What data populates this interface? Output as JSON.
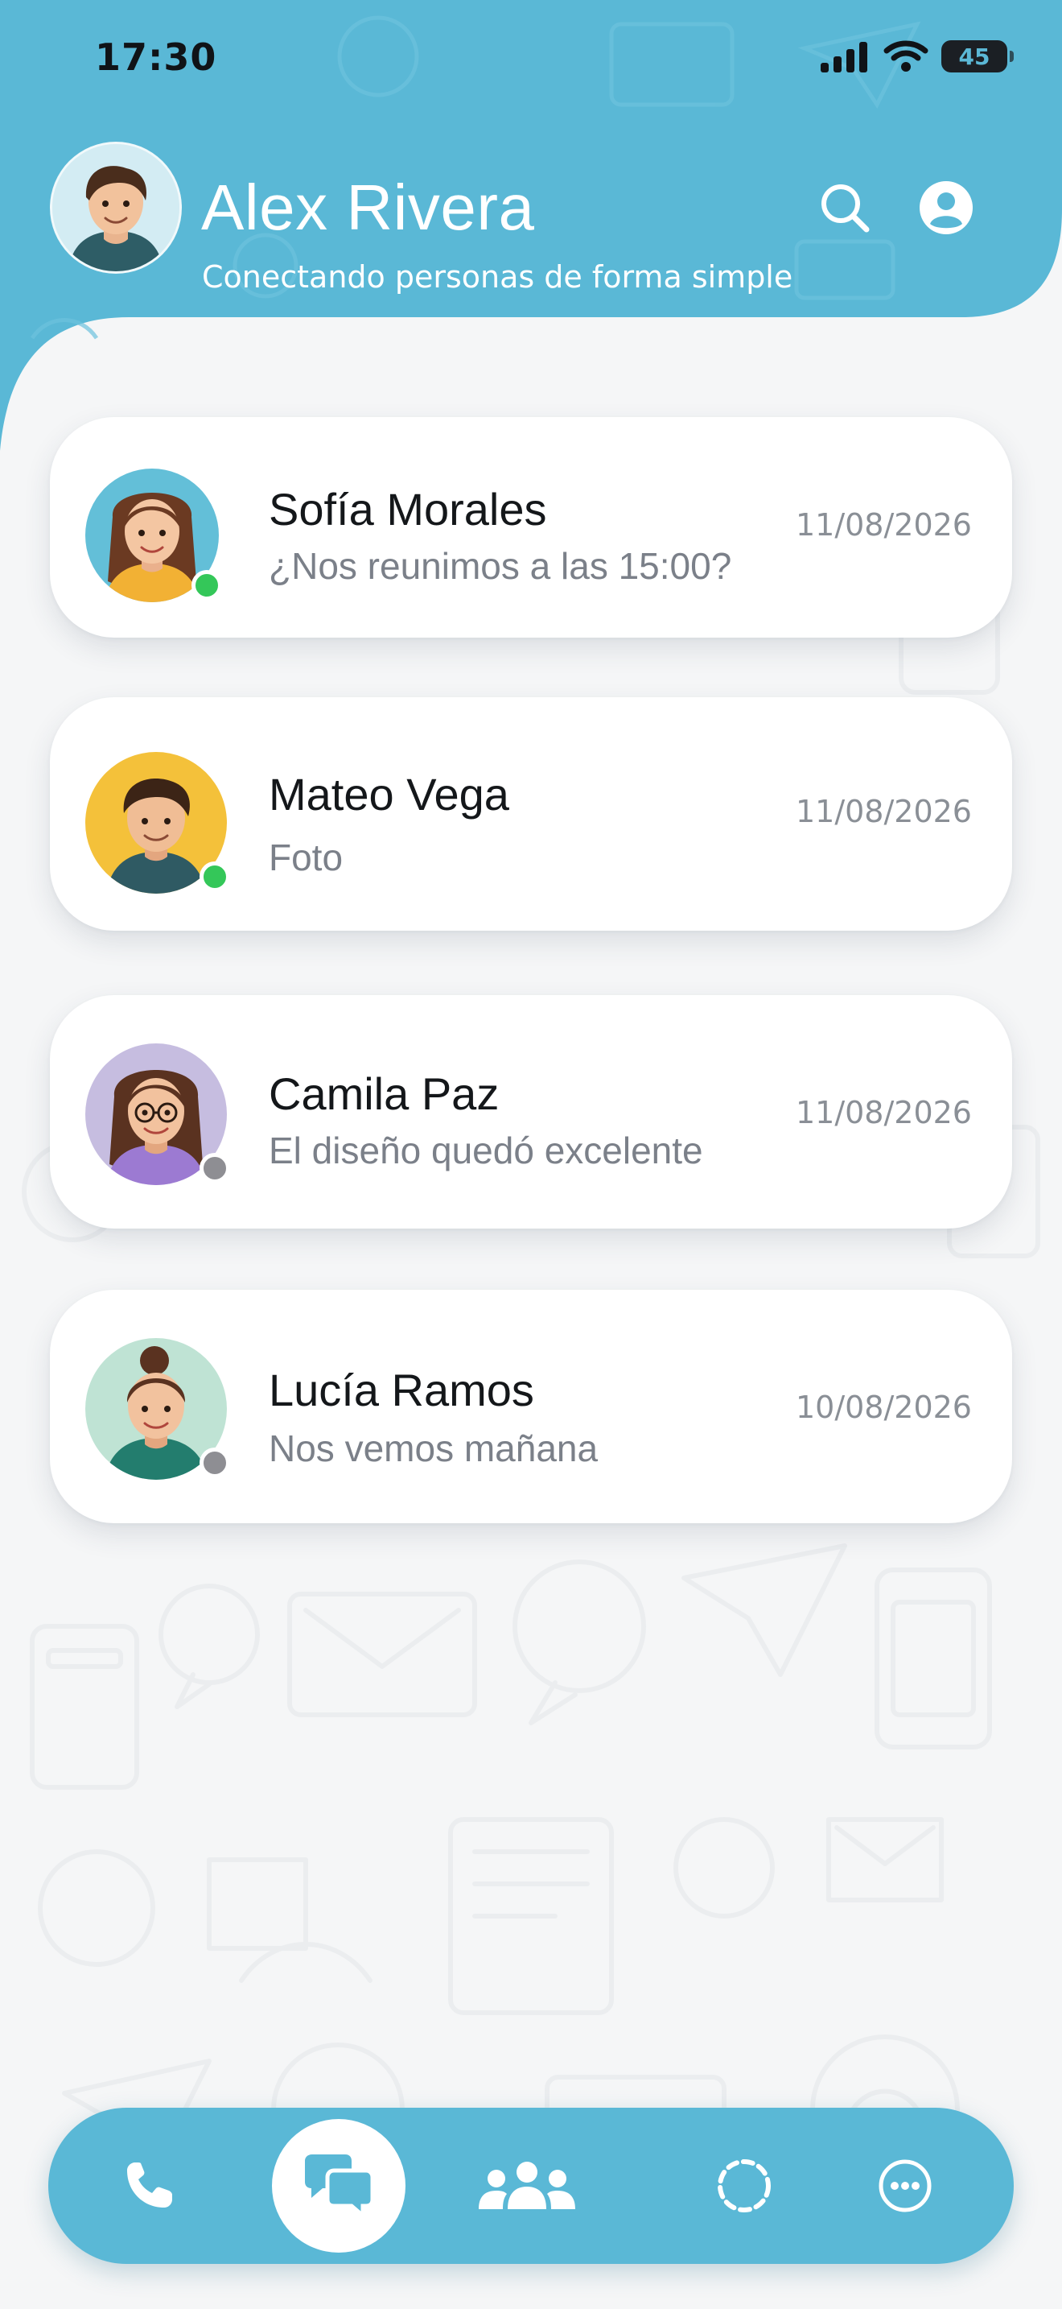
{
  "status_bar": {
    "time": "17:30",
    "battery_level": "45",
    "battery_fraction": 0.45
  },
  "header": {
    "name": "Alex Rivera",
    "tagline": "Conectando personas de forma simple",
    "search_icon": "search-icon",
    "account_icon": "account-circle-icon"
  },
  "chats": [
    {
      "name": "Sofía Morales",
      "preview": "¿Nos reunimos a las 15:00?",
      "date": "11/08/2026",
      "online": true
    },
    {
      "name": "Mateo Vega",
      "preview": "Foto",
      "date": "11/08/2026",
      "online": true
    },
    {
      "name": "Camila Paz",
      "preview": "El diseño quedó excelente",
      "date": "11/08/2026",
      "online": false
    },
    {
      "name": "Lucía Ramos",
      "preview": "Nos vemos mañana",
      "date": "10/08/2026",
      "online": false
    }
  ],
  "bottom_nav": {
    "items": [
      "phone-icon",
      "chats-icon",
      "contacts-group-icon",
      "status-icon",
      "more-options-icon"
    ],
    "active": "chats-icon"
  },
  "colors": {
    "brand": "#5ab8d6",
    "online": "#34c759",
    "offline": "#8e8e93"
  }
}
